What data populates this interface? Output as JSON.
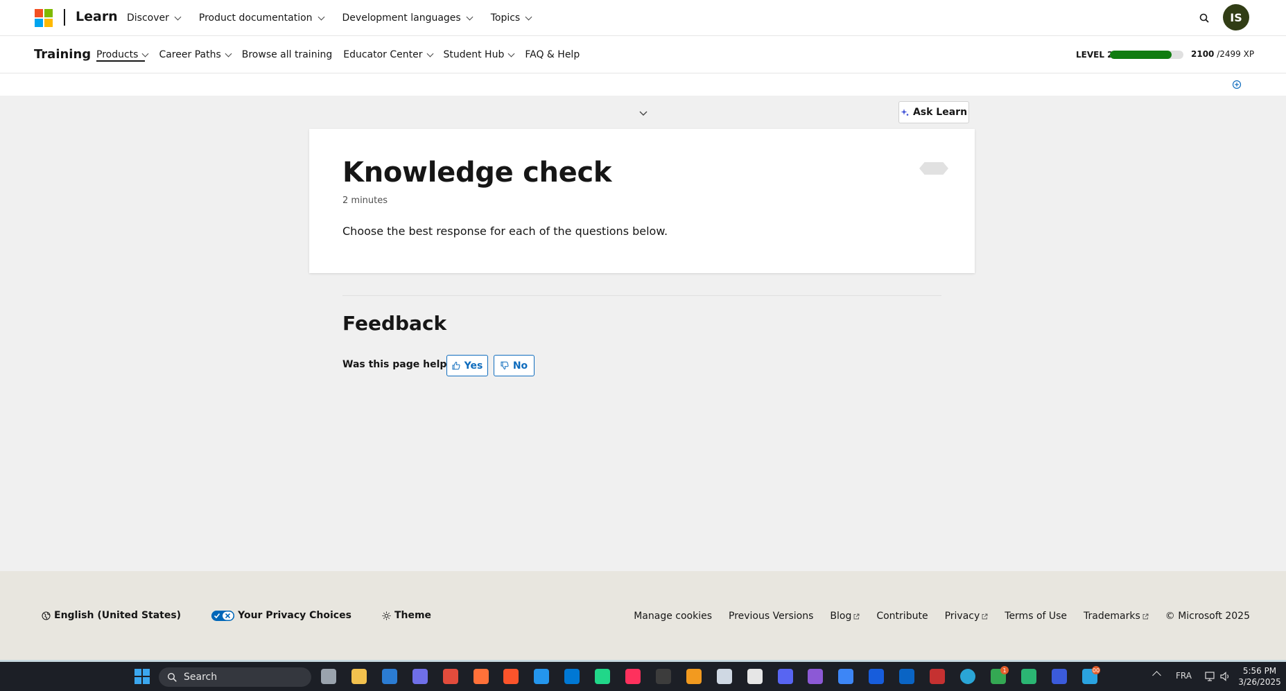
{
  "header": {
    "brand": "Learn",
    "nav": [
      {
        "label": "Discover"
      },
      {
        "label": "Product documentation"
      },
      {
        "label": "Development languages"
      },
      {
        "label": "Topics"
      }
    ],
    "avatar_initials": "IS"
  },
  "training": {
    "title": "Training",
    "nav": [
      {
        "label": "Products",
        "active": true,
        "dropdown": true
      },
      {
        "label": "Career Paths",
        "dropdown": true
      },
      {
        "label": "Browse all training",
        "dropdown": false
      },
      {
        "label": "Educator Center",
        "dropdown": true
      },
      {
        "label": "Student Hub",
        "dropdown": true
      },
      {
        "label": "FAQ & Help",
        "dropdown": false
      }
    ],
    "level_label": "LEVEL 2",
    "xp_current": "2100",
    "xp_total": "/2499 XP",
    "xp_progress": 0.84,
    "xp_color": "#107c10"
  },
  "main": {
    "ask_learn_label": "Ask Learn",
    "unit": {
      "title": "Knowledge check",
      "duration": "2 minutes",
      "instructions": "Choose the best response for each of the questions below."
    },
    "feedback": {
      "title": "Feedback",
      "question": "Was this page helpful?",
      "yes_label": "Yes",
      "no_label": "No"
    }
  },
  "footer": {
    "locale": "English (United States)",
    "privacy_choices": "Your Privacy Choices",
    "theme": "Theme",
    "links": [
      {
        "label": "Manage cookies",
        "external": false
      },
      {
        "label": "Previous Versions",
        "external": false
      },
      {
        "label": "Blog",
        "external": true
      },
      {
        "label": "Contribute",
        "external": false
      },
      {
        "label": "Privacy",
        "external": true
      },
      {
        "label": "Terms of Use",
        "external": false
      },
      {
        "label": "Trademarks",
        "external": true
      }
    ],
    "copyright": "© Microsoft 2025"
  },
  "taskbar": {
    "search_label": "Search",
    "language": "FRA",
    "time": "5:56 PM",
    "date": "3/26/2025",
    "apps": [
      {
        "name": "task-view",
        "color": "#9aa3ad"
      },
      {
        "name": "file-explorer",
        "color": "#f2c14e"
      },
      {
        "name": "microsoft-store",
        "color": "#2b7cd3"
      },
      {
        "name": "copilot",
        "color": "#6f6fe8"
      },
      {
        "name": "chrome",
        "color": "#e24c3c"
      },
      {
        "name": "firefox",
        "color": "#ff7139"
      },
      {
        "name": "brave",
        "color": "#fb542b"
      },
      {
        "name": "docker",
        "color": "#2496ed"
      },
      {
        "name": "vscode",
        "color": "#0078d4"
      },
      {
        "name": "pycharm",
        "color": "#21d789"
      },
      {
        "name": "intellij",
        "color": "#fe315d"
      },
      {
        "name": "terminal",
        "color": "#3c3c3c"
      },
      {
        "name": "virtual-desktop",
        "color": "#f29a1f"
      },
      {
        "name": "virtualbox",
        "color": "#cfd8e3"
      },
      {
        "name": "ai-assistant",
        "color": "#e6e6e6"
      },
      {
        "name": "discord",
        "color": "#5865f2"
      },
      {
        "name": "visual-studio",
        "color": "#8c59d6"
      },
      {
        "name": "app-shield",
        "color": "#3d86f6"
      },
      {
        "name": "bitwarden",
        "color": "#175ddc"
      },
      {
        "name": "outlook",
        "color": "#0a64c4"
      },
      {
        "name": "voicemeeter",
        "color": "#c53131"
      },
      {
        "name": "edge",
        "color": "#2aa5d6"
      },
      {
        "name": "chrome-profile",
        "color": "#34a853"
      },
      {
        "name": "edge-dev",
        "color": "#2bb673"
      },
      {
        "name": "arc",
        "color": "#3b5bdb"
      },
      {
        "name": "telegram",
        "color": "#2aa3e0"
      }
    ],
    "badges": {
      "chrome-profile": "1",
      "telegram": "00"
    }
  }
}
